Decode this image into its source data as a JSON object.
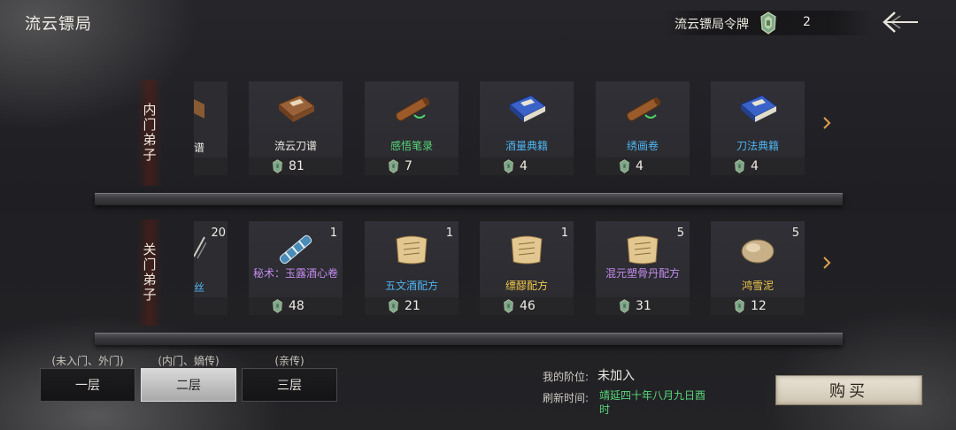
{
  "header": {
    "title": "流云镖局",
    "token_label": "流云镖局令牌",
    "token_count": "2",
    "back_icon": "back-arrow-icon"
  },
  "shelves": {
    "inner": {
      "label": "内门弟子",
      "partial_text": "谱",
      "items": [
        {
          "name": "流云刀谱",
          "price": "81",
          "color": "white",
          "icon": "book-brown-icon"
        },
        {
          "name": "感悟笔录",
          "price": "7",
          "color": "green",
          "icon": "scroll-roll-icon"
        },
        {
          "name": "酒量典籍",
          "price": "4",
          "color": "blue",
          "icon": "book-blue-icon"
        },
        {
          "name": "绣画卷",
          "price": "4",
          "color": "blue",
          "icon": "scroll-roll-icon"
        },
        {
          "name": "刀法典籍",
          "price": "4",
          "color": "blue",
          "icon": "book-blue-icon"
        }
      ]
    },
    "outer": {
      "label": "关门弟子",
      "partial_text": "丝",
      "partial_count": "20",
      "items": [
        {
          "name": "秘术：玉露酒心卷",
          "count": "1",
          "price": "48",
          "color": "purple",
          "icon": "scroll-blue-icon"
        },
        {
          "name": "五文酒配方",
          "count": "1",
          "price": "21",
          "color": "blue",
          "icon": "recipe-scroll-icon"
        },
        {
          "name": "缥醪配方",
          "count": "1",
          "price": "46",
          "color": "gold",
          "icon": "recipe-scroll-icon"
        },
        {
          "name": "混元塑骨丹配方",
          "count": "5",
          "price": "31",
          "color": "purple",
          "icon": "recipe-scroll-icon"
        },
        {
          "name": "鸿雪泥",
          "count": "5",
          "price": "12",
          "color": "gold",
          "icon": "stone-icon"
        }
      ]
    }
  },
  "floors": [
    {
      "hint": "(未入门、外门)",
      "label": "一层",
      "active": false
    },
    {
      "hint": "(内门、嫡传)",
      "label": "二层",
      "active": true
    },
    {
      "hint": "(亲传)",
      "label": "三层",
      "active": false
    }
  ],
  "info": {
    "rank_label": "我的阶位:",
    "rank_value": "未加入",
    "refresh_label": "刷新时间:",
    "refresh_value": "靖延四十年八月九日酉时"
  },
  "buy_label": "购买",
  "colors": {
    "white": "#f0ece4",
    "green": "#57d87a",
    "blue": "#4fb4f0",
    "purple": "#c58cf0",
    "gold": "#f2c94a"
  }
}
